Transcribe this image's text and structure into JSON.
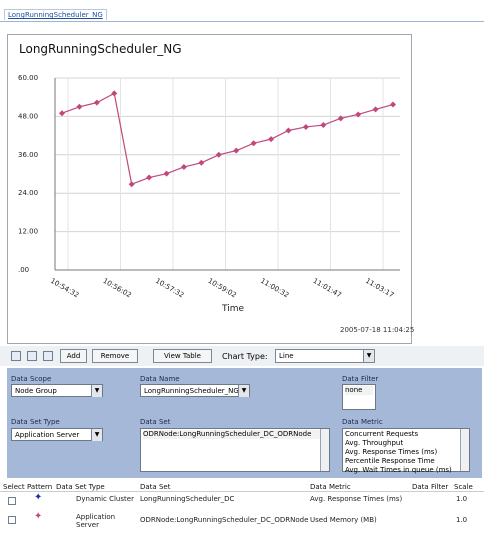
{
  "tab": {
    "label": "LongRunningScheduler_NG"
  },
  "chart_data": {
    "type": "line",
    "title": "LongRunningScheduler_NG",
    "xlabel": "Time",
    "ylabel": "",
    "ylim": [
      0,
      60
    ],
    "yticks": [
      "60.00",
      "48.00",
      "36.00",
      "24.00",
      "12.00",
      ".00"
    ],
    "xticks": [
      "10:54:32",
      "10:56:02",
      "10:57:32",
      "10:59:02",
      "11:00:32",
      "11:01:47",
      "11:03:17"
    ],
    "timestamp": "2005-07-18 11:04:25",
    "grid": true,
    "series": [
      {
        "color": "#c2477c",
        "values": [
          49.0,
          51.0,
          52.3,
          55.2,
          26.8,
          28.9,
          30.1,
          32.2,
          33.5,
          36.0,
          37.3,
          39.6,
          40.9,
          43.6,
          44.7,
          45.3,
          47.4,
          48.6,
          50.2,
          51.7
        ]
      }
    ]
  },
  "toolbar": {
    "add_label": "Add",
    "remove_label": "Remove",
    "view_table_label": "View Table",
    "chart_type_label": "Chart Type:",
    "chart_type_value": "Line"
  },
  "config": {
    "data_scope_label": "Data Scope",
    "data_scope_value": "Node Group",
    "data_name_label": "Data Name",
    "data_name_value": "LongRunningScheduler_NG",
    "data_filter_label": "Data Filter",
    "data_filter_items": [
      "none"
    ],
    "data_set_type_label": "Data Set Type",
    "data_set_type_value": "Application Server",
    "data_set_label": "Data Set",
    "data_set_items": [
      "ODRNode:LongRunningScheduler_DC_ODRNode"
    ],
    "data_metric_label": "Data Metric",
    "data_metric_items": [
      "Concurrent Requests",
      "Avg. Throughput",
      "Avg. Response Times (ms)",
      "Percentile Response Time",
      "Avg. Wait Times in queue (ms)"
    ]
  },
  "table": {
    "headers": [
      "Select",
      "Pattern",
      "Data Set Type",
      "Data Set",
      "Data Metric",
      "Data Filter",
      "Scale"
    ],
    "rows": [
      {
        "pattern_color": "#1b2fa0",
        "type": "Dynamic Cluster",
        "set": "LongRunningScheduler_DC",
        "metric": "Avg. Response Times (ms)",
        "filter": "",
        "scale": "1.0"
      },
      {
        "pattern_color": "#c2477c",
        "type": "Application Server",
        "set": "ODRNode:LongRunningScheduler_DC_ODRNode",
        "metric": "Used Memory (MB)",
        "filter": "",
        "scale": "1.0"
      }
    ]
  }
}
